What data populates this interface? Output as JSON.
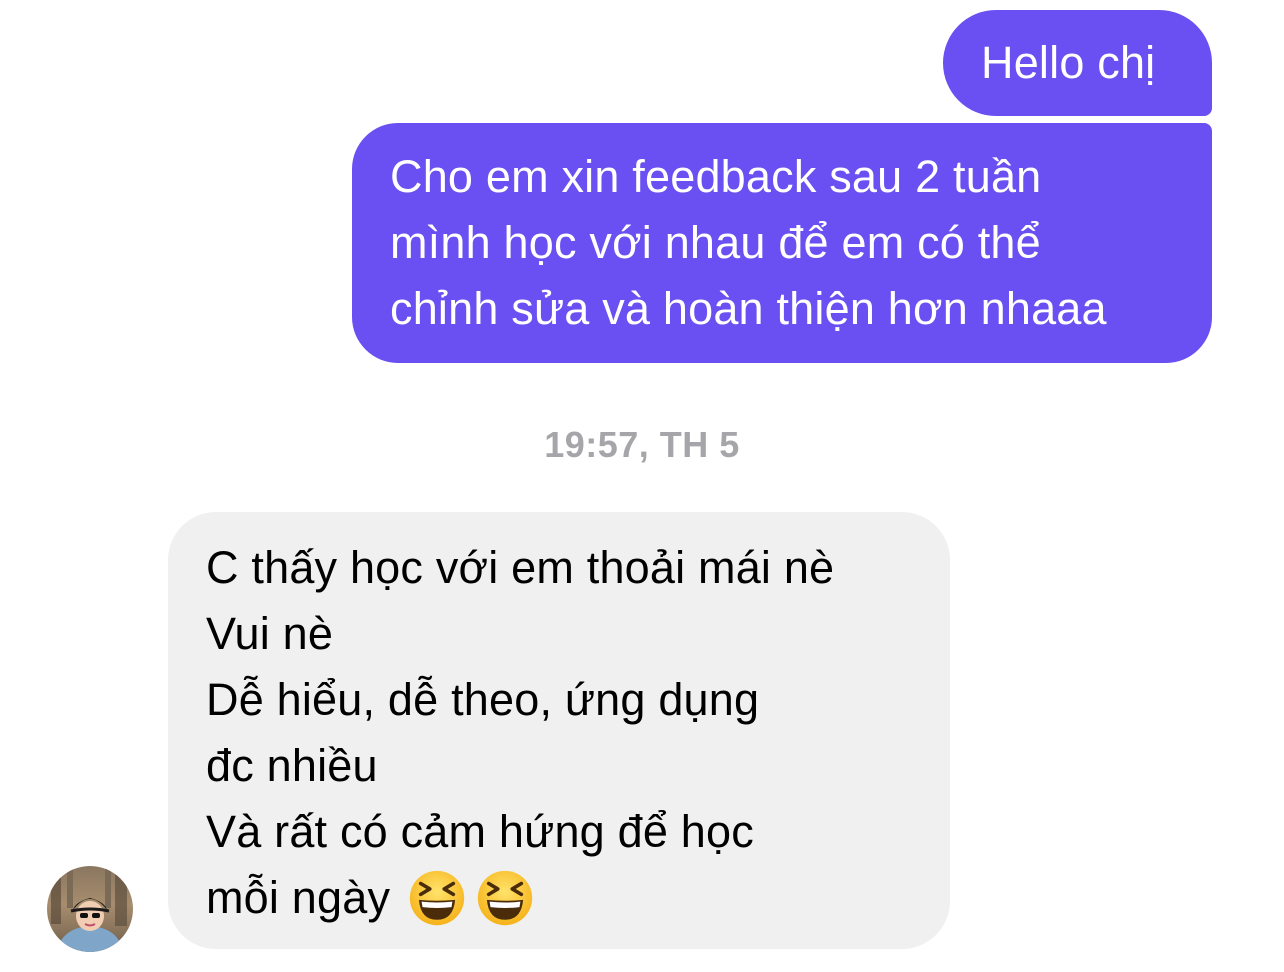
{
  "messages": [
    {
      "sender": "me",
      "lines": [
        "Hello chị"
      ]
    },
    {
      "sender": "me",
      "lines": [
        "Cho em xin feedback sau 2 tuần",
        "mình học với nhau để em có thể",
        "chỉnh sửa và hoàn thiện hơn nhaaa"
      ]
    },
    {
      "sender": "other",
      "lines": [
        "C thấy học với em thoải mái nè",
        "Vui nè",
        "Dễ hiểu, dễ theo, ứng dụng",
        "đc nhiều",
        "Và rất có cảm hứng để học",
        "mỗi ngày"
      ],
      "emojis": [
        "grinning-squinting-face-icon",
        "grinning-squinting-face-icon"
      ]
    }
  ],
  "timestamp": "19:57, TH 5",
  "colors": {
    "sent_bubble": "#6A4FF2",
    "received_bubble": "#F0F0F0",
    "timestamp": "#A6A6AA"
  }
}
